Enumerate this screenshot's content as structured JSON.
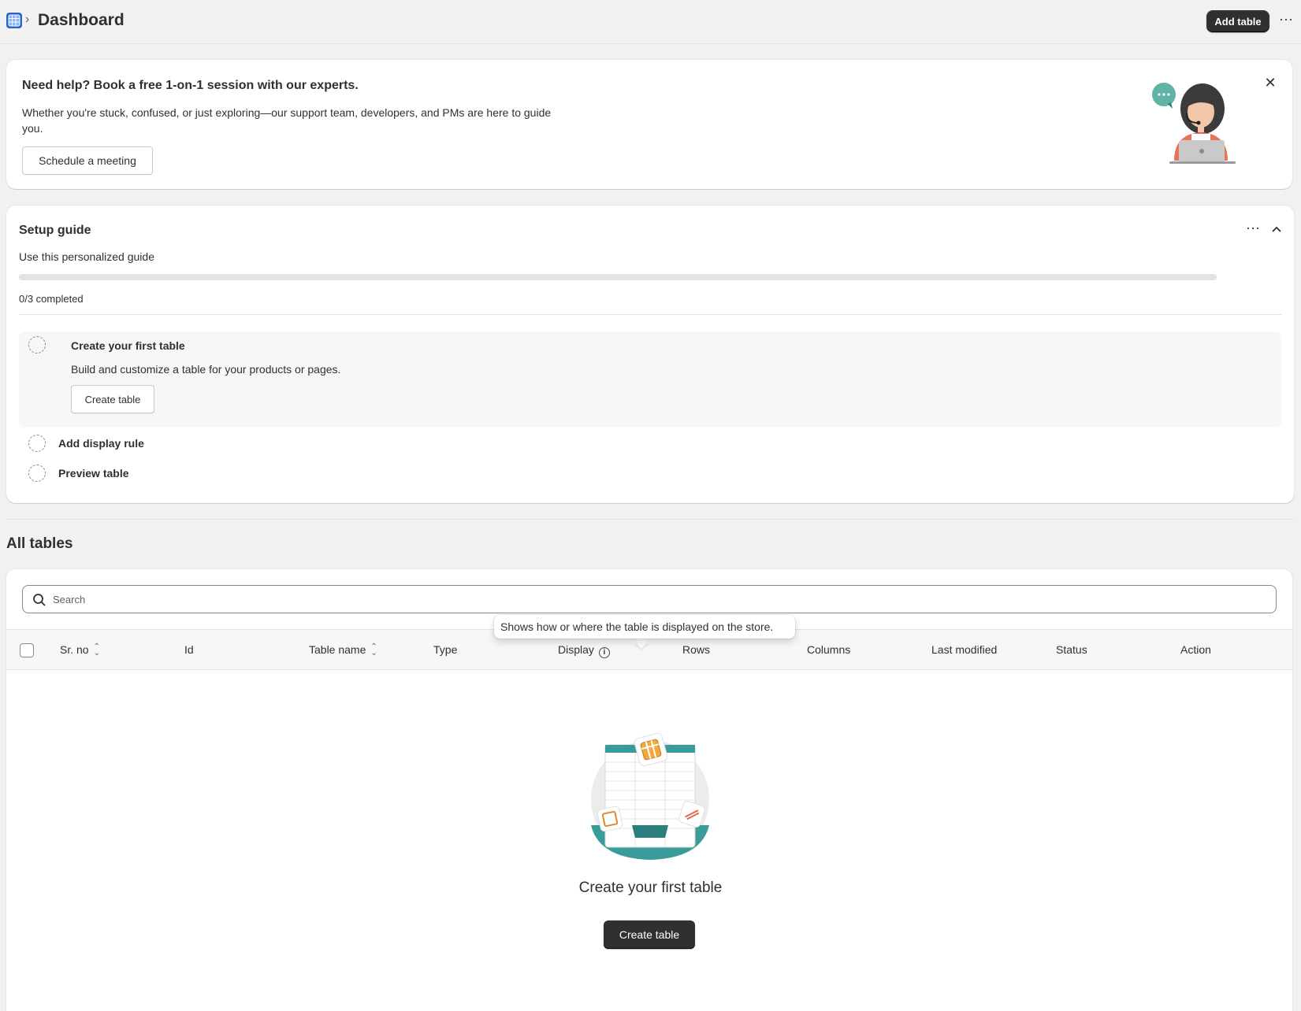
{
  "header": {
    "breadcrumb_separator": "›",
    "title": "Dashboard",
    "add_table_label": "Add table",
    "more_label": "···"
  },
  "help_card": {
    "title": "Need help? Book a free 1-on-1 session with our experts.",
    "body": "Whether you're stuck, confused, or just exploring—our support team, developers, and PMs are here to guide you.",
    "button_label": "Schedule a meeting",
    "close_label": "✕"
  },
  "setup_guide": {
    "title": "Setup guide",
    "subtitle": "Use this personalized guide",
    "progress": 0,
    "progress_text": "0/3 completed",
    "steps": [
      {
        "title": "Create your first table",
        "description": "Build and customize a table for your products or pages.",
        "button_label": "Create table"
      },
      {
        "title": "Add display rule"
      },
      {
        "title": "Preview table"
      }
    ]
  },
  "all_tables": {
    "title": "All tables",
    "search": {
      "placeholder": "Search",
      "value": ""
    },
    "columns": [
      "Sr. no",
      "Id",
      "Table name",
      "Type",
      "Display",
      "Rows",
      "Columns",
      "Last modified",
      "Status",
      "Action"
    ],
    "tooltip": "Shows how or where the table is displayed on the store.",
    "empty_state": {
      "title": "Create your first table",
      "button_label": "Create table"
    }
  },
  "colors": {
    "primary_button": "#303030",
    "background": "#f1f1f1",
    "teal": "#3a9c9a",
    "accent_orange": "#e08a2c"
  },
  "icons": {
    "app": "table-grid-icon",
    "search": "search-icon",
    "info": "info-icon",
    "sort": "sort-icon",
    "close": "close-icon",
    "collapse": "chevron-up-icon"
  }
}
